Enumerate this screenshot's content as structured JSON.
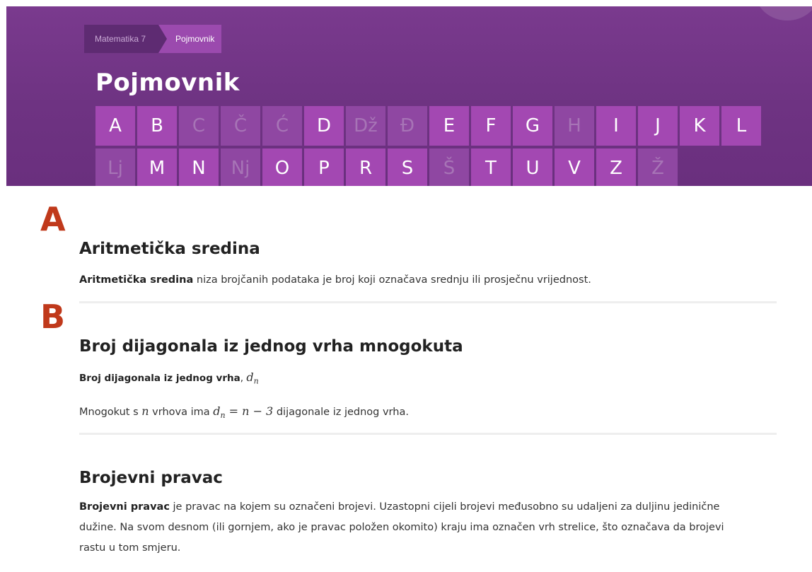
{
  "breadcrumb": {
    "parent": "Matematika 7",
    "current": "Pojmovnik"
  },
  "page_title": "Pojmovnik",
  "alphabet": [
    {
      "letter": "A",
      "enabled": true
    },
    {
      "letter": "B",
      "enabled": true
    },
    {
      "letter": "C",
      "enabled": false
    },
    {
      "letter": "Č",
      "enabled": false
    },
    {
      "letter": "Ć",
      "enabled": false
    },
    {
      "letter": "D",
      "enabled": true
    },
    {
      "letter": "Dž",
      "enabled": false
    },
    {
      "letter": "Đ",
      "enabled": false
    },
    {
      "letter": "E",
      "enabled": true
    },
    {
      "letter": "F",
      "enabled": true
    },
    {
      "letter": "G",
      "enabled": true
    },
    {
      "letter": "H",
      "enabled": false
    },
    {
      "letter": "I",
      "enabled": true
    },
    {
      "letter": "J",
      "enabled": true
    },
    {
      "letter": "K",
      "enabled": true
    },
    {
      "letter": "L",
      "enabled": true
    },
    {
      "letter": "Lj",
      "enabled": false
    },
    {
      "letter": "M",
      "enabled": true
    },
    {
      "letter": "N",
      "enabled": true
    },
    {
      "letter": "Nj",
      "enabled": false
    },
    {
      "letter": "O",
      "enabled": true
    },
    {
      "letter": "P",
      "enabled": true
    },
    {
      "letter": "R",
      "enabled": true
    },
    {
      "letter": "S",
      "enabled": true
    },
    {
      "letter": "Š",
      "enabled": false
    },
    {
      "letter": "T",
      "enabled": true
    },
    {
      "letter": "U",
      "enabled": true
    },
    {
      "letter": "V",
      "enabled": true
    },
    {
      "letter": "Z",
      "enabled": true
    },
    {
      "letter": "Ž",
      "enabled": false
    }
  ],
  "sections": {
    "a": {
      "letter": "A",
      "term1": {
        "title": "Aritmetička sredina",
        "bold": "Aritmetička sredina",
        "text": " niza brojčanih podataka je broj koji označava srednju ili prosječnu vrijednost."
      }
    },
    "b": {
      "letter": "B",
      "term1": {
        "title": "Broj dijagonala iz jednog vrha mnogokuta",
        "subtitle_bold": "Broj dijagonala iz jednog vrha",
        "subtitle_sep": ", ",
        "subtitle_math": "d",
        "subtitle_math_sub": "n",
        "line_pre": "Mnogokut s ",
        "line_n": "n",
        "line_mid": " vrhova ima ",
        "line_formula_d": "d",
        "line_formula_sub": "n",
        "line_formula_rest": " = n − 3",
        "line_post": " dijagonale iz jednog vrha."
      },
      "term2": {
        "title": "Brojevni pravac",
        "bold": "Brojevni pravac",
        "line1": " je pravac na kojem su označeni brojevi. Uzastopni cijeli brojevi međusobno su udaljeni za duljinu jedinične",
        "line2": "dužine. Na svom desnom (ili gornjem, ako je pravac položen okomito) kraju ima označen vrh strelice, što označava da brojevi",
        "line3": "rastu u tom smjeru."
      }
    }
  }
}
